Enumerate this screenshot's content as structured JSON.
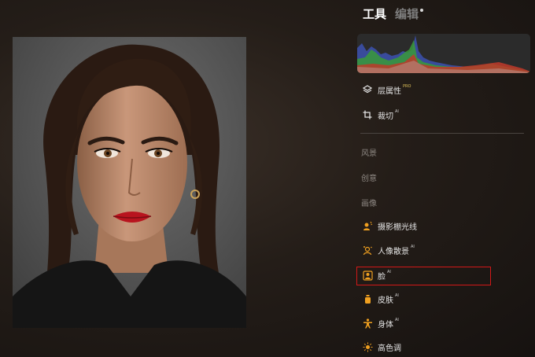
{
  "tabs": {
    "tools": "工具",
    "edit": "编辑"
  },
  "colors": {
    "accent_orange": "#f0a020",
    "highlight_red": "#d21818"
  },
  "menu": {
    "layers": {
      "label": "层属性",
      "badge": "PRO",
      "icon": "layers-icon"
    },
    "crop": {
      "label": "裁切",
      "badge": "AI",
      "icon": "crop-icon"
    }
  },
  "sections": {
    "landscape": "风景",
    "creative": "创意",
    "portrait": "画像"
  },
  "portrait_items": [
    {
      "label": "摄影棚光线",
      "badge": "",
      "icon": "studio-light-icon"
    },
    {
      "label": "人像散景",
      "badge": "AI",
      "icon": "portrait-bokeh-icon"
    },
    {
      "label": "脸",
      "badge": "AI",
      "icon": "face-icon"
    },
    {
      "label": "皮肤",
      "badge": "AI",
      "icon": "skin-icon"
    },
    {
      "label": "身体",
      "badge": "AI",
      "icon": "body-icon"
    },
    {
      "label": "高色调",
      "badge": "",
      "icon": "high-key-icon"
    }
  ]
}
